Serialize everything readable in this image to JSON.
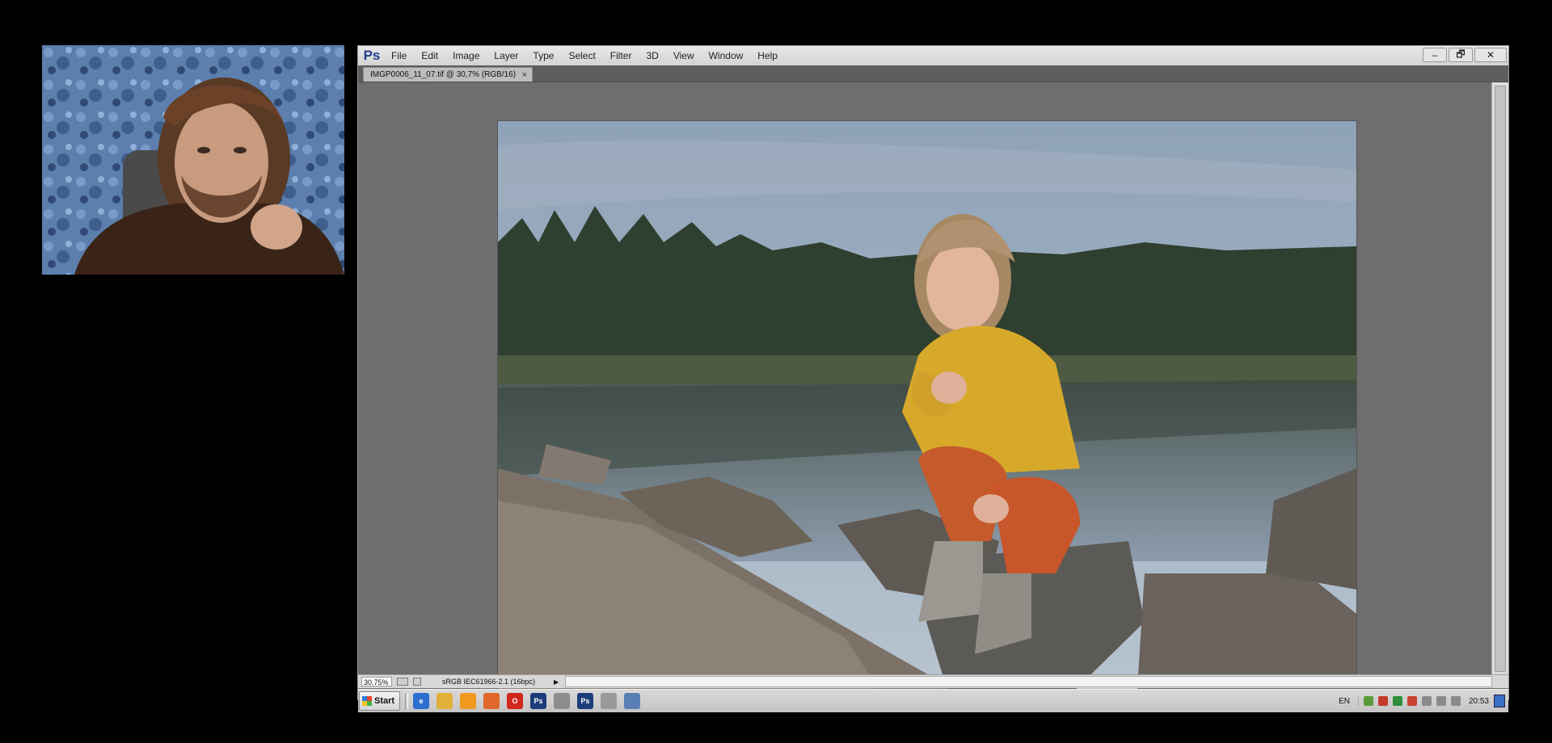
{
  "app": {
    "logo": "Ps",
    "menu": [
      "File",
      "Edit",
      "Image",
      "Layer",
      "Type",
      "Select",
      "Filter",
      "3D",
      "View",
      "Window",
      "Help"
    ],
    "window_controls": [
      "–",
      "🗗",
      "✕"
    ]
  },
  "document": {
    "tab_title": "IMGP0006_11_07.tif @ 30,7% (RGB/16)",
    "tab_close": "×"
  },
  "status": {
    "zoom": "30.75%",
    "profile": "sRGB IEC61966-2.1 (16bpc)",
    "arrow": "▶"
  },
  "taskbar": {
    "start_label": "Start",
    "icons": [
      {
        "name": "ie-icon",
        "color": "#2d6fcf",
        "label": "e"
      },
      {
        "name": "explorer-icon",
        "color": "#e0b038",
        "label": ""
      },
      {
        "name": "media-icon",
        "color": "#f19a1f",
        "label": ""
      },
      {
        "name": "firefox-icon",
        "color": "#e0682a",
        "label": ""
      },
      {
        "name": "opera-icon",
        "color": "#d0281c",
        "label": "O"
      },
      {
        "name": "photoshop-icon",
        "color": "#1d3c7a",
        "label": "Ps"
      },
      {
        "name": "network-icon",
        "color": "#8c8c8c",
        "label": ""
      },
      {
        "name": "photoshop-2-icon",
        "color": "#1d3c7a",
        "label": "Ps"
      },
      {
        "name": "user-icon",
        "color": "#9a9a9a",
        "label": ""
      },
      {
        "name": "window-icon",
        "color": "#5a7fb5",
        "label": ""
      }
    ],
    "language": "EN",
    "tray_colors": [
      "#5a9c3a",
      "#c23a2a",
      "#2f8f3a",
      "#c8442e",
      "#8a8a8a",
      "#8a8a8a",
      "#8a8a8a"
    ],
    "clock": "20:53"
  }
}
